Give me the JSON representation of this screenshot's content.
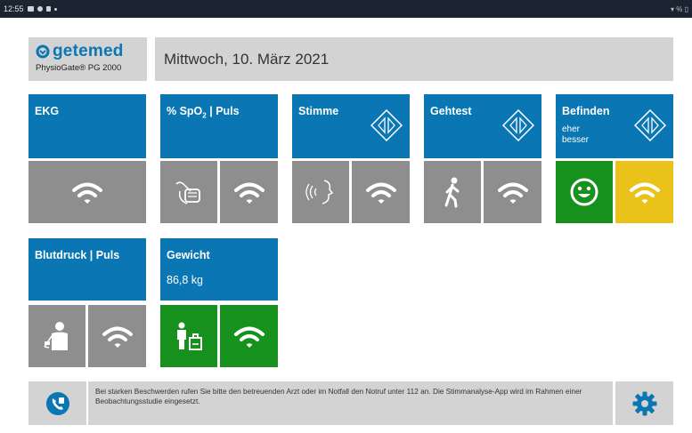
{
  "statusbar": {
    "time": "12:55",
    "right": "▾ % ▯"
  },
  "logo": {
    "brand": "getemed",
    "product": "PhysioGate® PG 2000"
  },
  "date": "Mittwoch, 10. März 2021",
  "tiles": {
    "ekg": {
      "label": "EKG"
    },
    "spo2": {
      "label_prefix": "% SpO",
      "label_sub": "2",
      "label_suffix": " | Puls"
    },
    "stimme": {
      "label": "Stimme"
    },
    "gehtest": {
      "label": "Gehtest"
    },
    "befinden": {
      "label": "Befinden",
      "status_line1": "eher",
      "status_line2": "besser"
    },
    "blutdruck": {
      "label": "Blutdruck | Puls"
    },
    "gewicht": {
      "label": "Gewicht",
      "value": "86,8 kg"
    }
  },
  "footer": {
    "notice": "Bei starken Beschwerden rufen Sie bitte den betreuenden Arzt oder im Notfall den Notruf unter 112 an. Die Stimmanalyse-App wird im Rahmen einer Beobachtungsstudie eingesetzt."
  },
  "colors": {
    "accent": "#0a76b3",
    "tile_gray": "#8e8e8e",
    "good_green": "#16911d",
    "warn_yellow": "#eac21a",
    "panel": "#d3d3d3"
  },
  "icons": [
    "wifi-icon",
    "finger-clip-icon",
    "voice-icon",
    "walking-person-icon",
    "smiley-icon",
    "blood-pressure-person-icon",
    "scale-icon",
    "diamond-arrows-icon",
    "help-phone-icon",
    "gear-icon"
  ]
}
